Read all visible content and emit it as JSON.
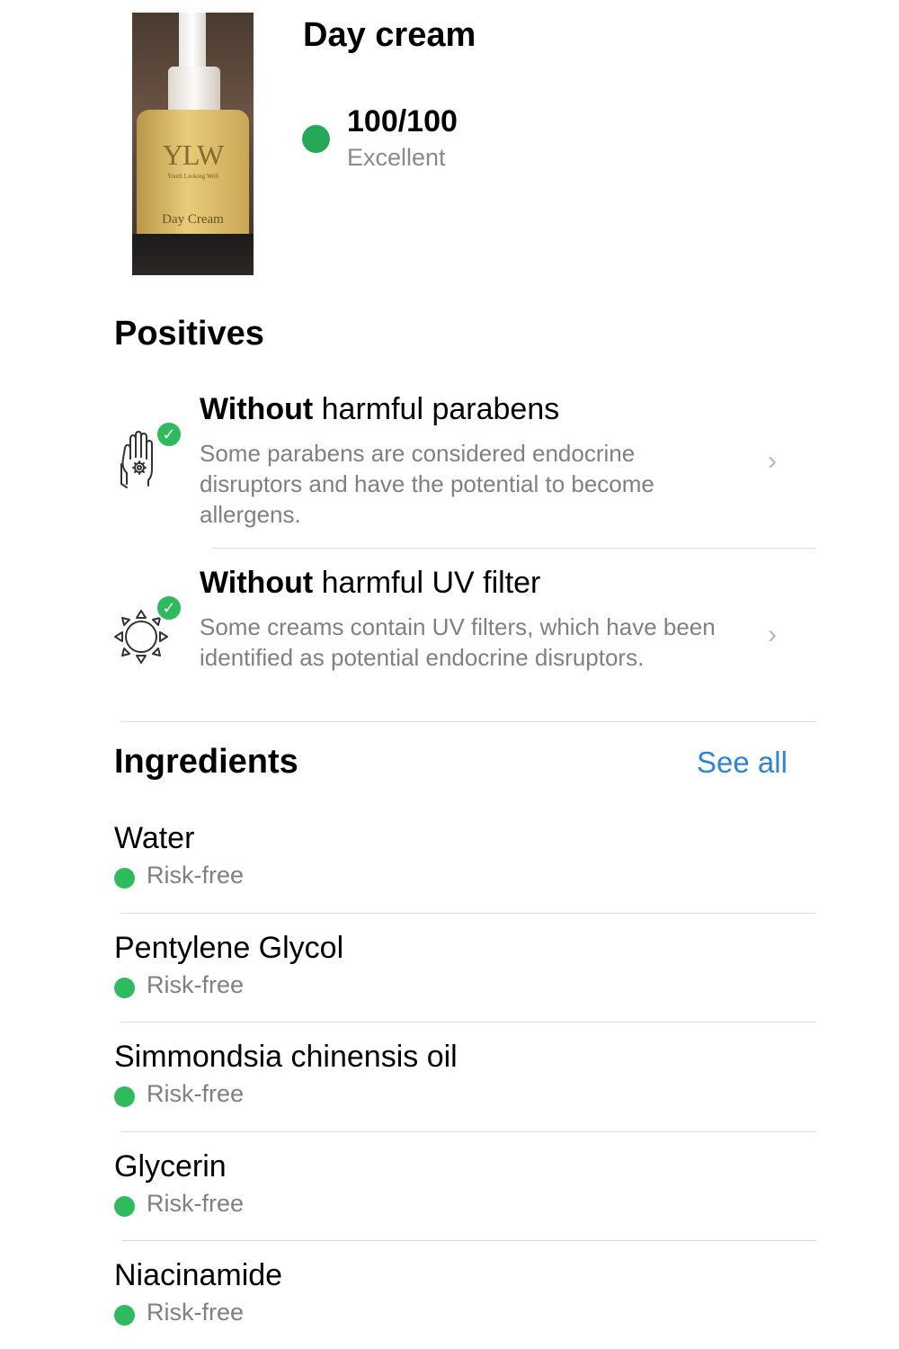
{
  "product": {
    "name": "Day cream",
    "image": {
      "brand": "YLW",
      "brand_sub": "Youth Looking Well",
      "label": "Day Cream"
    },
    "score": {
      "value": "100/100",
      "label": "Excellent",
      "color": "#27a859"
    }
  },
  "positives": {
    "title": "Positives",
    "items": [
      {
        "title_bold": "Without",
        "title_rest": " harmful parabens",
        "description": "Some parabens are considered endocrine disruptors and have the potential to become allergens.",
        "icon": "hand-icon"
      },
      {
        "title_bold": "Without",
        "title_rest": " harmful UV filter",
        "description": "Some creams contain UV filters, which have been identified as potential endocrine disruptors.",
        "icon": "sun-icon"
      }
    ]
  },
  "ingredients": {
    "title": "Ingredients",
    "see_all": "See all",
    "items": [
      {
        "name": "Water",
        "risk": "Risk-free"
      },
      {
        "name": "Pentylene Glycol",
        "risk": "Risk-free"
      },
      {
        "name": "Simmondsia chinensis oil",
        "risk": "Risk-free"
      },
      {
        "name": "Glycerin",
        "risk": "Risk-free"
      },
      {
        "name": "Niacinamide",
        "risk": "Risk-free"
      }
    ],
    "risk_color": "#2dbb5d"
  },
  "colors": {
    "accent_link": "#2f84d6",
    "secondary_text": "#7f7f84",
    "check_green": "#2dbb5d"
  }
}
